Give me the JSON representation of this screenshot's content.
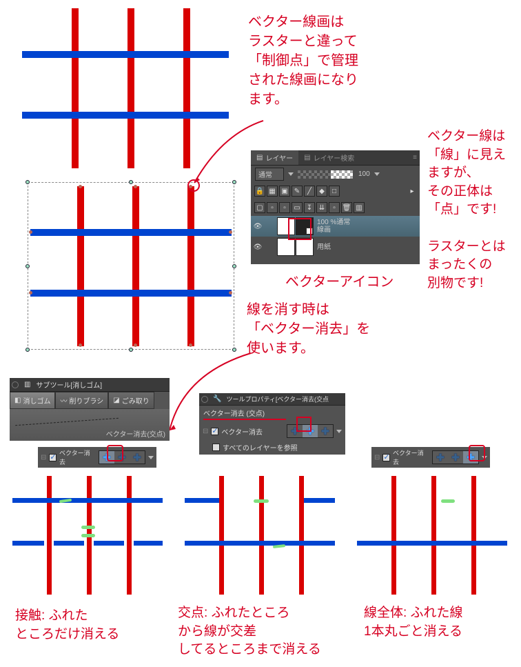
{
  "annotations": {
    "top_right": "ベクター線画は\nラスターと違って\n「制御点」で管理\nされた線画になり\nます。",
    "side_right": "ベクター線は\n「線」に見え\nますが、\nその正体は\n「点」です!\n\nラスターとは\nまったくの\n別物です!",
    "vector_icon_label": "ベクターアイコン",
    "erase_note": "線を消す時は\n「ベクター消去」を\n使います。",
    "bottom_left": "接触: ふれた\nところだけ消える",
    "bottom_mid": "交点: ふれたところ\nから線が交差\nしてるところまで消える",
    "bottom_right": "線全体: ふれた線\n1本丸ごと消える"
  },
  "layers_panel": {
    "tab_layer": "レイヤー",
    "tab_layer_search": "レイヤー検索",
    "blend_mode": "通常",
    "opacity": "100",
    "layer1_pct": "100 %通常",
    "layer1_name": "線画",
    "layer2_name": "用紙"
  },
  "subtool_panel": {
    "title": "サブツール[消しゴム]",
    "btn_eraser": "消しゴム",
    "btn_brush": "削りブラシ",
    "btn_dust": "ごみ取り",
    "preview_label": "ベクター消去(交点)"
  },
  "toolprop_panel": {
    "title": "ツールプロパティ[ベクター消去(交点",
    "subtitle": "ベクター消去 (交点)",
    "check_label": "ベクター消去",
    "all_layers": "すべてのレイヤーを参照"
  },
  "mode_bar": {
    "label": "ベクター消去"
  }
}
